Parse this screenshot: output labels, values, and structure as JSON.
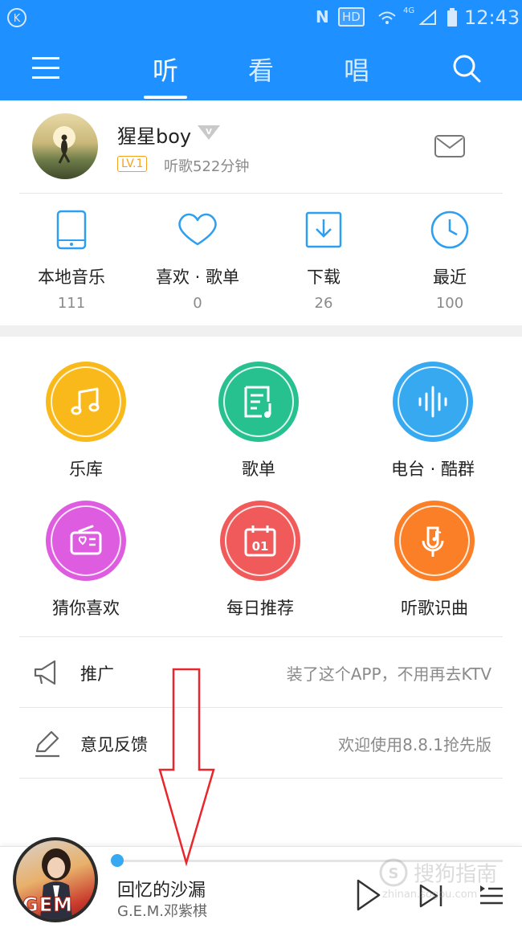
{
  "status_bar": {
    "nfc": "N",
    "hd": "HD",
    "network": "4G",
    "time": "12:43"
  },
  "nav": {
    "tabs": [
      {
        "label": "听",
        "active": true
      },
      {
        "label": "看",
        "active": false
      },
      {
        "label": "唱",
        "active": false
      }
    ]
  },
  "profile": {
    "username": "猩星boy",
    "level": "LV.1",
    "listen_time": "听歌522分钟"
  },
  "quick_items": [
    {
      "label": "本地音乐",
      "count": "111",
      "icon": "phone-icon"
    },
    {
      "label": "喜欢 · 歌单",
      "count": "0",
      "icon": "heart-icon"
    },
    {
      "label": "下载",
      "count": "26",
      "icon": "download-icon"
    },
    {
      "label": "最近",
      "count": "100",
      "icon": "clock-icon"
    }
  ],
  "features": [
    {
      "label": "乐库",
      "color": "#f9b91b",
      "icon": "music-note-icon"
    },
    {
      "label": "歌单",
      "color": "#27c08f",
      "icon": "playlist-icon"
    },
    {
      "label": "电台 · 酷群",
      "color": "#36a9f1",
      "icon": "soundwave-icon"
    },
    {
      "label": "猜你喜欢",
      "color": "#de5ce0",
      "icon": "radio-icon"
    },
    {
      "label": "每日推荐",
      "color": "#f15a5a",
      "icon": "calendar-icon"
    },
    {
      "label": "听歌识曲",
      "color": "#fb7f26",
      "icon": "mic-music-icon"
    }
  ],
  "rows": [
    {
      "label": "推广",
      "value": "装了这个APP，不用再去KTV",
      "icon": "megaphone-icon"
    },
    {
      "label": "意见反馈",
      "value": "欢迎使用8.8.1抢先版",
      "icon": "pencil-icon"
    }
  ],
  "player": {
    "song_title": "回忆的沙漏",
    "artist": "G.E.M.邓紫棋",
    "album_art_text": "GEM",
    "progress": 0.0
  },
  "watermark": {
    "text": "搜狗指南",
    "url": "zhinan.sogou.com"
  },
  "colors": {
    "brand_blue": "#1e90ff",
    "icon_blue": "#2e9ef0",
    "annotation_red": "#e8262b",
    "level_orange": "#f4a21c"
  }
}
